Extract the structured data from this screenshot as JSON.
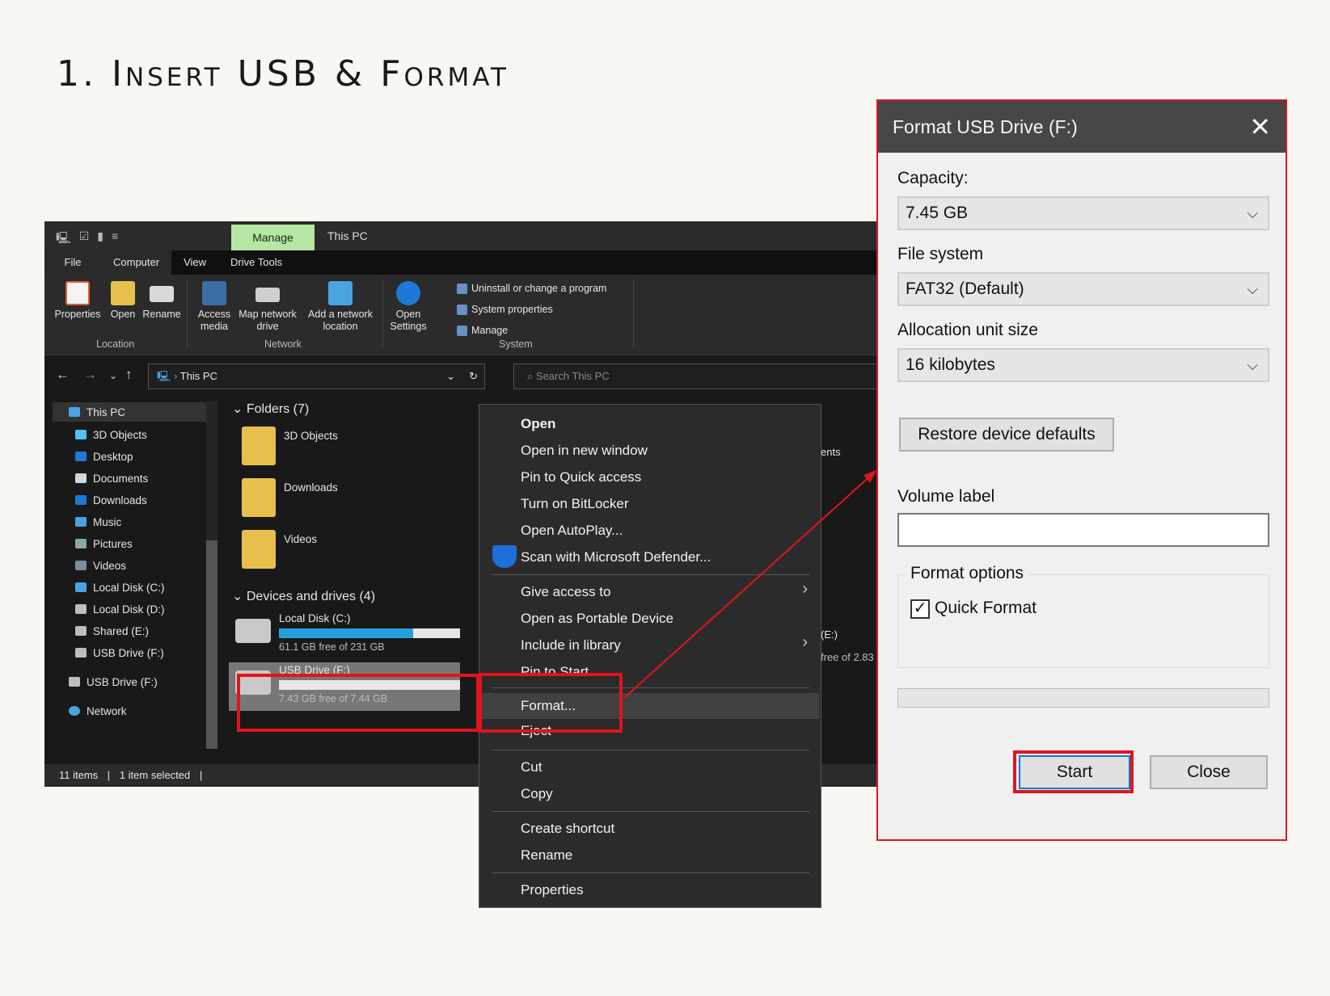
{
  "heading": "1. Insert USB & Format",
  "explorer": {
    "context_tab": "Manage",
    "window_title": "This PC",
    "ribbon_tabs": [
      "File",
      "Computer",
      "View",
      "Drive Tools"
    ],
    "ribbon_groups": {
      "location": {
        "label": "Location",
        "buttons": [
          "Properties",
          "Open",
          "Rename"
        ]
      },
      "network": {
        "label": "Network",
        "buttons": [
          "Access media",
          "Map network drive",
          "Add a network location"
        ]
      },
      "system": {
        "label": "System",
        "open_settings": "Open Settings",
        "items": [
          "Uninstall or change a program",
          "System properties",
          "Manage"
        ]
      }
    },
    "address": "This PC",
    "search_placeholder": "Search This PC",
    "nav_items": [
      "This PC",
      "3D Objects",
      "Desktop",
      "Documents",
      "Downloads",
      "Music",
      "Pictures",
      "Videos",
      "Local Disk (C:)",
      "Local Disk (D:)",
      "Shared (E:)",
      "USB Drive (F:)",
      "USB Drive (F:)",
      "Network"
    ],
    "folders_header": "Folders (7)",
    "folders": [
      "3D Objects",
      "Downloads",
      "Videos"
    ],
    "drives_header": "Devices and drives (4)",
    "drives": [
      {
        "name": "Local Disk (C:)",
        "free": "61.1 GB free of 231 GB",
        "used_fraction": 0.74
      },
      {
        "name": "USB Drive (F:)",
        "free": "7.43 GB free of 7.44 GB",
        "used_fraction": 0.0
      }
    ],
    "peek": {
      "ents": "ents",
      "e_label": "(E:)",
      "e_free": "free of 2.83"
    },
    "status": {
      "items": "11 items",
      "selected": "1 item selected"
    }
  },
  "context_menu": {
    "items": [
      "Open",
      "Open in new window",
      "Pin to Quick access",
      "Turn on BitLocker",
      "Open AutoPlay...",
      "Scan with Microsoft Defender...",
      "Give access to",
      "Open as Portable Device",
      "Include in library",
      "Pin to Start",
      "Format...",
      "Eject",
      "Cut",
      "Copy",
      "Create shortcut",
      "Rename",
      "Properties"
    ]
  },
  "format_dialog": {
    "title": "Format USB Drive (F:)",
    "capacity_label": "Capacity:",
    "capacity_value": "7.45 GB",
    "fs_label": "File system",
    "fs_value": "FAT32 (Default)",
    "alloc_label": "Allocation unit size",
    "alloc_value": "16 kilobytes",
    "restore_label": "Restore device defaults",
    "volume_label": "Volume label",
    "volume_value": "",
    "options_label": "Format options",
    "quick_format_label": "Quick Format",
    "quick_format_checked": true,
    "progress": 0,
    "start_label": "Start",
    "close_label": "Close"
  },
  "colors": {
    "highlight": "#e1141d",
    "manage_tab": "#b6e6a4",
    "drive_bar": "#26a0da"
  }
}
